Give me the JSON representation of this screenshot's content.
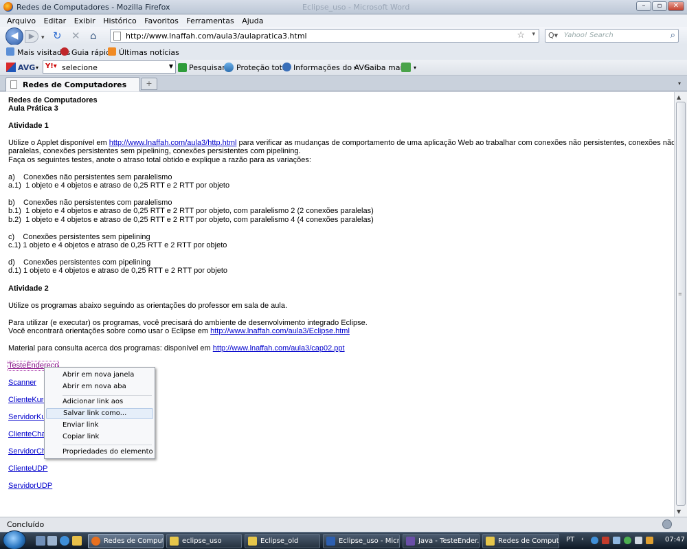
{
  "window": {
    "title": "Redes de Computadores - Mozilla Firefox",
    "background_title": "Eclipse_uso - Microsoft Word"
  },
  "menubar": [
    "Arquivo",
    "Editar",
    "Exibir",
    "Histórico",
    "Favoritos",
    "Ferramentas",
    "Ajuda"
  ],
  "navbar": {
    "url": "http://www.lnaffah.com/aula3/aulapratica3.html",
    "search_placeholder": "Yahoo! Search"
  },
  "bookmarks": [
    "Mais visitados",
    "Guia rápido",
    "Últimas notícias"
  ],
  "avgbar": {
    "brand": "AVG",
    "select_value": "selecione",
    "search": "Pesquisar",
    "protection": "Proteção total",
    "info": "Informações do AVG",
    "more": "Saiba mais"
  },
  "tab": {
    "label": "Redes de Computadores",
    "new_tab": "+"
  },
  "content": {
    "heading1": "Redes de Computadores",
    "heading2": "Aula Prática 3",
    "act1_title": "Atividade 1",
    "act1_p1_pre": "Utilize o Applet disponível em ",
    "act1_p1_link": "http://www.lnaffah.com/aula3/http.html",
    "act1_p1_post": " para verificar as mudanças de comportamento de uma aplicação Web ao trabalhar com conexões não persistentes, conexões não persistentes",
    "act1_p1_line2": "paralelas, conexões persistentes sem pipelining, conexões persistentes com pipelining.",
    "act1_p2": "Faça os seguintes testes, anote o atraso total obtido e explique a razão para as variações:",
    "a_title": "a)    Conexões não persistentes sem paralelismo",
    "a1": "a.1)  1 objeto e 4 objetos e atraso de 0,25 RTT e 2 RTT por objeto",
    "b_title": "b)    Conexões não persistentes com paralelismo",
    "b1": "b.1)  1 objeto e 4 objetos e atraso de 0,25 RTT e 2 RTT por objeto, com paralelismo 2 (2 conexões paralelas)",
    "b2": "b.2)  1 objeto e 4 objetos e atraso de 0,25 RTT e 2 RTT por objeto, com paralelismo 4 (4 conexões paralelas)",
    "c_title": "c)    Conexões persistentes sem pipelining",
    "c1": "c.1) 1 objeto e 4 objetos e atraso de 0,25 RTT e 2 RTT por objeto",
    "d_title": "d)    Conexões persistentes com pipelining",
    "d1": "d.1) 1 objeto e 4 objetos e atraso de 0,25 RTT e 2 RTT por objeto",
    "act2_title": "Atividade 2",
    "act2_p1": "Utilize os programas abaixo seguindo as orientações do professor em sala de aula.",
    "act2_p2": "Para utilizar (e executar) os programas, você precisará do ambiente de desenvolvimento integrado Eclipse.",
    "act2_p3_pre": "Você encontrará orientações sobre como usar o Eclipse em ",
    "act2_p3_link": "http://www.lnaffah.com/aula3/Eclipse.html",
    "act2_p4_pre": "Material para consulta acerca dos programas: disponível em ",
    "act2_p4_link": "http://www.lnaffah.com/aula3/cap02.ppt",
    "programs": [
      "TesteEndereco",
      "Scanner",
      "ClienteKuro",
      "ServidorKur",
      "ClienteChat",
      "ServidorCha",
      "ClienteUDP",
      "ServidorUDP"
    ]
  },
  "context_menu": [
    "Abrir em nova janela",
    "Abrir em nova aba",
    "Adicionar link aos favoritos",
    "Salvar link como...",
    "Enviar link",
    "Copiar link",
    "Propriedades do elemento"
  ],
  "status": "Concluído",
  "taskbar": {
    "items": [
      "Redes de Comput...",
      "eclipse_uso",
      "Eclipse_old",
      "Eclipse_uso - Micr...",
      "Java - TesteEnder...",
      "Redes de Computa..."
    ],
    "lang": "PT",
    "clock": "07:47"
  }
}
